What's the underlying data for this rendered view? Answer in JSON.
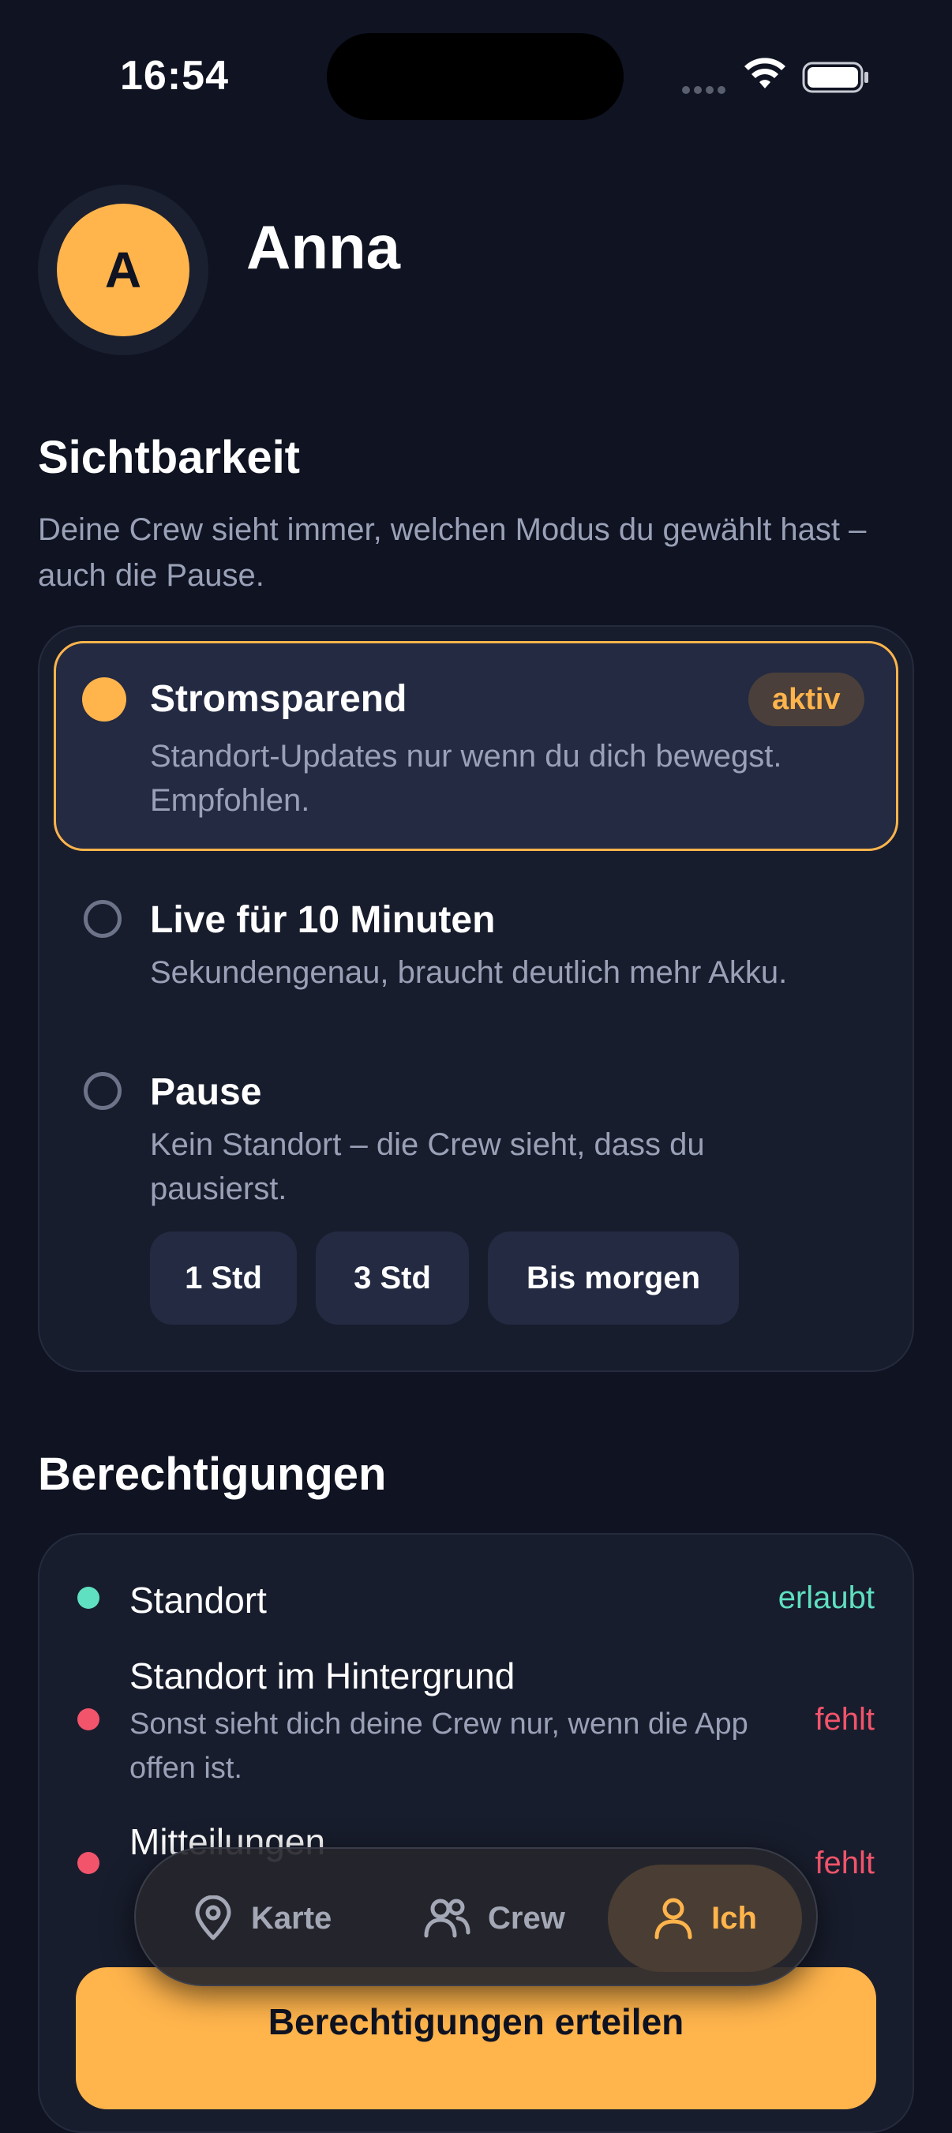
{
  "status_bar": {
    "time": "16:54"
  },
  "profile": {
    "avatar_initial": "A",
    "name": "Anna"
  },
  "visibility": {
    "heading": "Sichtbarkeit",
    "description": "Deine Crew sieht immer, welchen Modus du gewählt hast – auch die Pause.",
    "options": [
      {
        "title": "Stromsparend",
        "subtitle": "Standort-Updates nur wenn du dich bewegst. Empfohlen.",
        "badge": "aktiv",
        "selected": true
      },
      {
        "title": "Live für 10 Minuten",
        "subtitle": "Sekundengenau, braucht deutlich mehr Akku.",
        "selected": false
      },
      {
        "title": "Pause",
        "subtitle": "Kein Standort – die Crew sieht, dass du pausierst.",
        "selected": false
      }
    ],
    "pause_durations": [
      "1 Std",
      "3 Std",
      "Bis morgen"
    ]
  },
  "permissions": {
    "heading": "Berechtigungen",
    "items": [
      {
        "title": "Standort",
        "status": "erlaubt",
        "status_color": "#5fe0c0"
      },
      {
        "title": "Standort im Hintergrund",
        "subtitle": "Sonst sieht dich deine Crew nur, wenn die App offen ist.",
        "status": "fehlt",
        "status_color": "#f2546b"
      },
      {
        "title": "Mitteilungen",
        "status": "fehlt",
        "status_color": "#f2546b"
      }
    ],
    "grant_button": "Berechtigungen erteilen"
  },
  "tab_bar": {
    "tabs": [
      {
        "label": "Karte",
        "icon": "map-pin-icon"
      },
      {
        "label": "Crew",
        "icon": "people-icon"
      },
      {
        "label": "Ich",
        "icon": "person-icon",
        "active": true
      }
    ]
  },
  "colors": {
    "accent": "#ffb44c",
    "background": "#0f1322",
    "card": "#181d2d",
    "ok": "#5fe0c0",
    "missing": "#f2546b"
  }
}
